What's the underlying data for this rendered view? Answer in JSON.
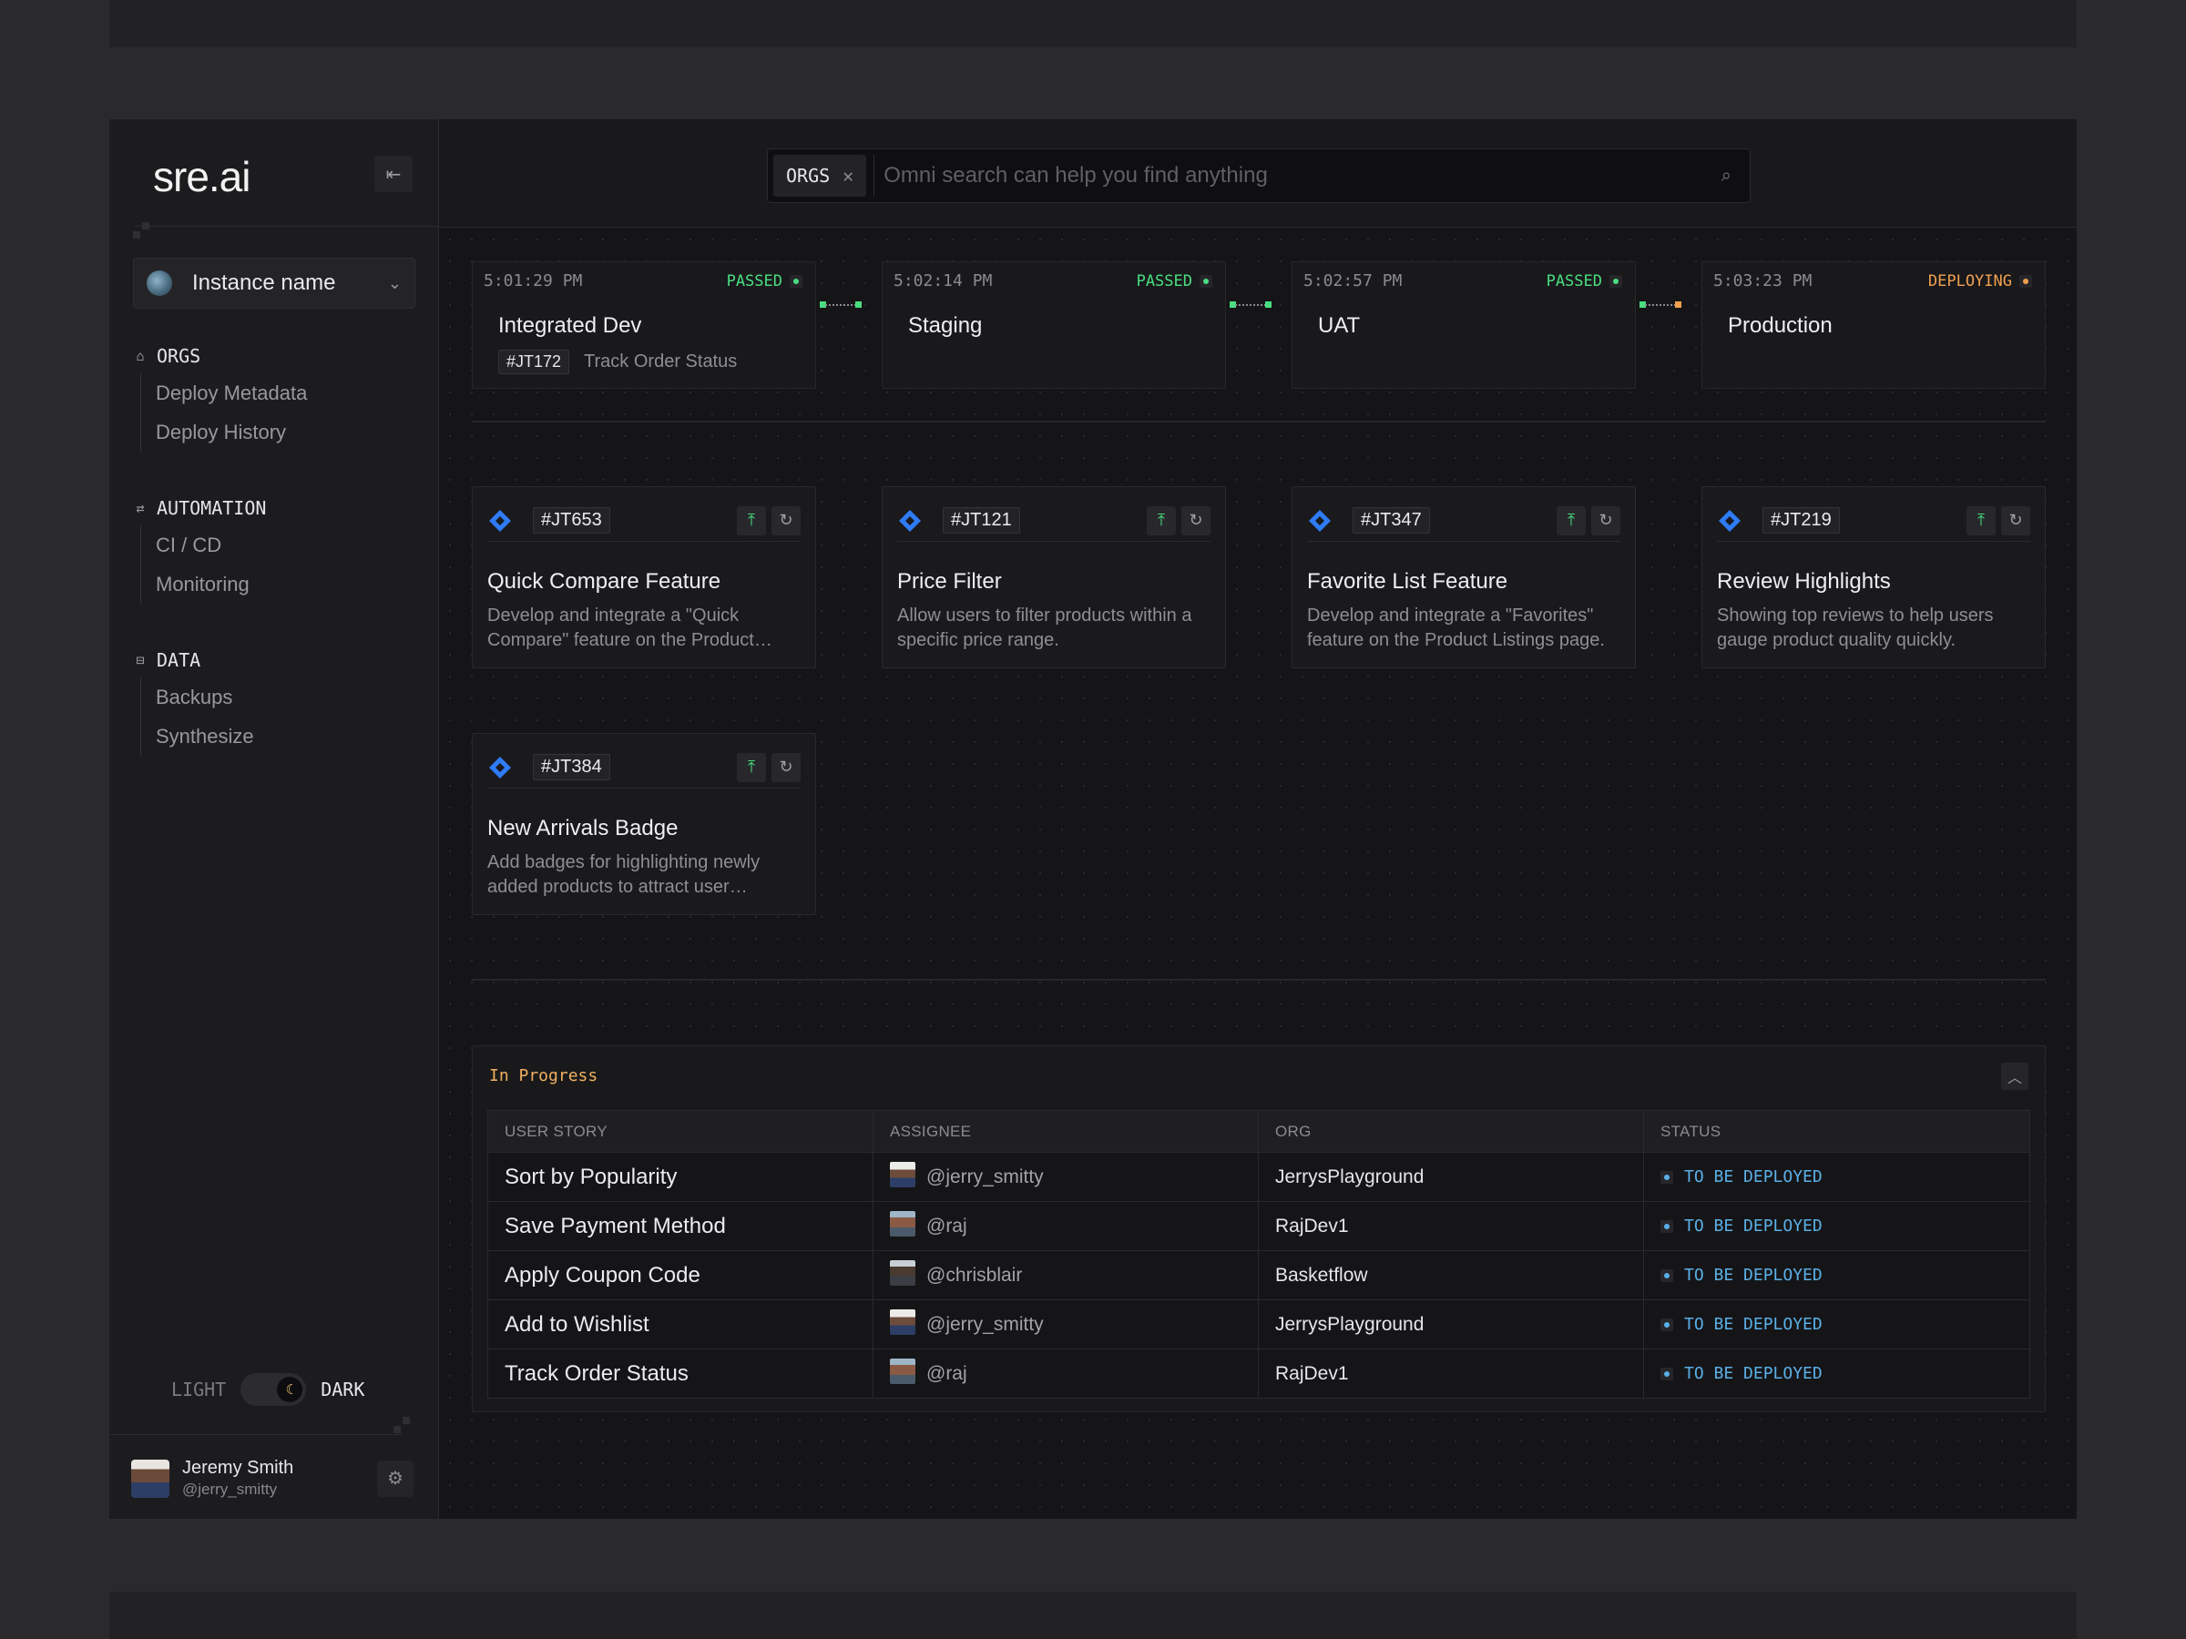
{
  "app": {
    "logo": "sre.ai",
    "instance": "Instance name"
  },
  "sidebar": {
    "groups": [
      {
        "title": "ORGS",
        "icon": "building-icon",
        "items": [
          "Deploy Metadata",
          "Deploy History"
        ]
      },
      {
        "title": "AUTOMATION",
        "icon": "repeat-icon",
        "items": [
          "CI / CD",
          "Monitoring"
        ]
      },
      {
        "title": "DATA",
        "icon": "database-icon",
        "items": [
          "Backups",
          "Synthesize"
        ]
      }
    ],
    "theme": {
      "light": "LIGHT",
      "dark": "DARK",
      "current": "dark"
    },
    "user": {
      "name": "Jeremy Smith",
      "handle": "@jerry_smitty"
    }
  },
  "search": {
    "chip": "ORGS",
    "placeholder": "Omni search can help you find anything"
  },
  "colors": {
    "passed": "#4ade80",
    "deploying": "#f0a050",
    "status_blue": "#5ab0e8",
    "jira_blue": "#2f7bf5"
  },
  "pipeline": [
    {
      "time": "5:01:29 PM",
      "status": "PASSED",
      "name": "Integrated Dev",
      "tag_id": "#JT172",
      "tag_text": "Track Order Status"
    },
    {
      "time": "5:02:14 PM",
      "status": "PASSED",
      "name": "Staging"
    },
    {
      "time": "5:02:57 PM",
      "status": "PASSED",
      "name": "UAT"
    },
    {
      "time": "5:03:23 PM",
      "status": "DEPLOYING",
      "name": "Production"
    }
  ],
  "cards": [
    {
      "id": "#JT653",
      "title": "Quick Compare Feature",
      "desc": "Develop and integrate a \"Quick Compare\" feature on the Product Listings page."
    },
    {
      "id": "#JT121",
      "title": "Price Filter",
      "desc": "Allow users to filter products within a specific price range."
    },
    {
      "id": "#JT347",
      "title": "Favorite List Feature",
      "desc": "Develop and integrate a \"Favorites\" feature on the Product Listings page."
    },
    {
      "id": "#JT219",
      "title": "Review Highlights",
      "desc": "Showing top reviews to help users gauge product quality quickly."
    },
    {
      "id": "#JT384",
      "title": "New Arrivals Badge",
      "desc": "Add badges for highlighting newly added products to attract user attention."
    }
  ],
  "in_progress": {
    "title": "In Progress",
    "columns": [
      "USER STORY",
      "ASSIGNEE",
      "ORG",
      "STATUS"
    ],
    "rows": [
      {
        "story": "Sort by Popularity",
        "assignee": "@jerry_smitty",
        "org": "JerrysPlayground",
        "status": "TO BE DEPLOYED"
      },
      {
        "story": "Save Payment Method",
        "assignee": "@raj",
        "org": "RajDev1",
        "status": "TO BE DEPLOYED"
      },
      {
        "story": "Apply Coupon Code",
        "assignee": "@chrisblair",
        "org": "Basketflow",
        "status": "TO BE DEPLOYED"
      },
      {
        "story": "Add to Wishlist",
        "assignee": "@jerry_smitty",
        "org": "JerrysPlayground",
        "status": "TO BE DEPLOYED"
      },
      {
        "story": "Track Order Status",
        "assignee": "@raj",
        "org": "RajDev1",
        "status": "TO BE DEPLOYED"
      }
    ]
  }
}
